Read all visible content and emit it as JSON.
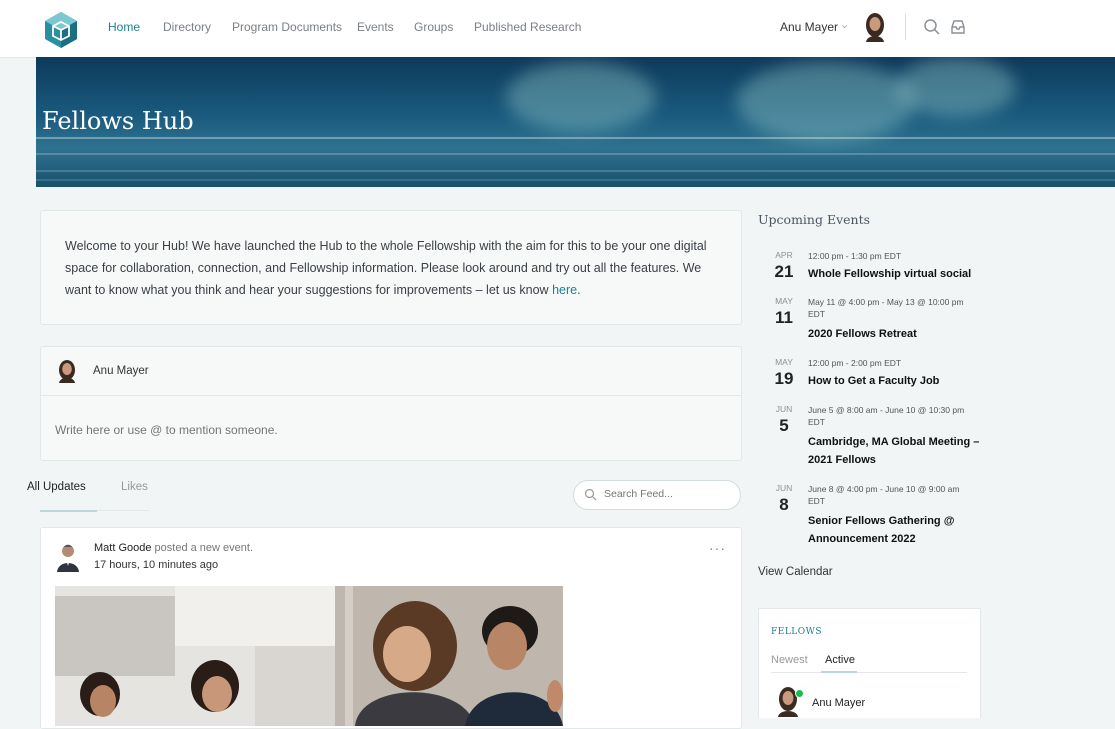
{
  "nav": {
    "links": [
      "Home",
      "Directory",
      "Program Documents",
      "Events",
      "Groups",
      "Published Research"
    ],
    "user_name": "Anu Mayer"
  },
  "banner": {
    "title": "Fellows Hub"
  },
  "welcome": {
    "text": "Welcome to your Hub! We have launched the Hub to the whole Fellowship with the aim for this to be your one digital space for collaboration, connection, and Fellowship information. Please look around and try out all the features. We want to know what you think and hear your suggestions for improvements – let us know ",
    "link_text": "here",
    "end": "."
  },
  "composer": {
    "user_name": "Anu Mayer",
    "placeholder": "Write here or use @ to mention someone."
  },
  "feed_tabs": [
    "All Updates",
    "Likes"
  ],
  "feed_search": {
    "placeholder": "Search Feed..."
  },
  "activity": {
    "user": "Matt Goode",
    "verb": "posted a new event.",
    "time": "17 hours, 10 minutes ago",
    "more": "···"
  },
  "events": {
    "title": "Upcoming Events",
    "items": [
      {
        "month": "APR",
        "day": "21",
        "time1": "12:00 pm - 1:30 pm EDT",
        "time2": "",
        "title1": "Whole Fellowship virtual social",
        "title2": ""
      },
      {
        "month": "MAY",
        "day": "11",
        "time1": "May 11 @ 4:00 pm - May 13 @ 10:00 pm",
        "time2": "EDT",
        "title1": "2020 Fellows Retreat",
        "title2": ""
      },
      {
        "month": "MAY",
        "day": "19",
        "time1": "12:00 pm - 2:00 pm EDT",
        "time2": "",
        "title1": "How to Get a Faculty Job",
        "title2": ""
      },
      {
        "month": "JUN",
        "day": "5",
        "time1": "June 5 @ 8:00 am - June 10 @ 10:30 pm",
        "time2": "EDT",
        "title1": "Cambridge, MA Global Meeting –",
        "title2": "2021 Fellows"
      },
      {
        "month": "JUN",
        "day": "8",
        "time1": "June 8 @ 4:00 pm - June 10 @ 9:00 am",
        "time2": "EDT",
        "title1": "Senior Fellows Gathering @",
        "title2": "Announcement 2022"
      }
    ],
    "view_calendar": "View Calendar"
  },
  "fellows": {
    "title": "FELLOWS",
    "tabs": [
      "Newest",
      "Active"
    ],
    "members": [
      "Anu Mayer"
    ]
  },
  "colors": {
    "accent": "#1b8290",
    "online": "#1db954"
  }
}
